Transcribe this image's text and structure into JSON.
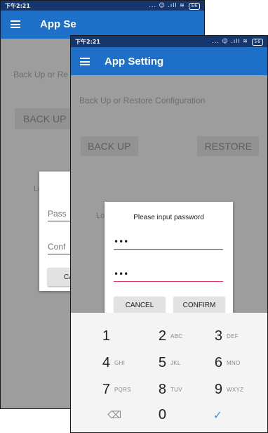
{
  "back_screen": {
    "status_time": "下午2:21",
    "status_icons": "... ☺ .ıll ≋",
    "battery": "56",
    "title": "App Se",
    "section_label": "Back Up or Re",
    "backup_label": "BACK UP",
    "login_fragment": "Lo",
    "password_fragment": "Pass",
    "confirm_fragment": "Conf",
    "cancel_fragment": "CA"
  },
  "front_screen": {
    "status_time": "下午2:21",
    "status_icons": "... ☺ .ıll ≋",
    "battery": "56",
    "title": "App Setting",
    "section_label": "Back Up or Restore Configuration",
    "backup_label": "BACK UP",
    "restore_label": "RESTORE",
    "login_fragment": "Lo",
    "dialog": {
      "title": "Please input password",
      "password_value": "•••",
      "confirm_value": "•••",
      "cancel_label": "CANCEL",
      "confirm_label": "CONFIRM"
    },
    "keypad": [
      {
        "digit": "1",
        "letters": ""
      },
      {
        "digit": "2",
        "letters": "ABC"
      },
      {
        "digit": "3",
        "letters": "DEF"
      },
      {
        "digit": "4",
        "letters": "GHI"
      },
      {
        "digit": "5",
        "letters": "JKL"
      },
      {
        "digit": "6",
        "letters": "MNO"
      },
      {
        "digit": "7",
        "letters": "PQRS"
      },
      {
        "digit": "8",
        "letters": "TUV"
      },
      {
        "digit": "9",
        "letters": "WXYZ"
      },
      {
        "digit": "⌫",
        "letters": ""
      },
      {
        "digit": "0",
        "letters": ""
      },
      {
        "digit": "✓",
        "letters": ""
      }
    ]
  },
  "colors": {
    "status_bar": "#14376f",
    "app_bar": "#1e6fc8",
    "dimmed_background": "#9d9d9d",
    "active_field_underline": "#e0336b",
    "done_key": "#4a90e2"
  }
}
